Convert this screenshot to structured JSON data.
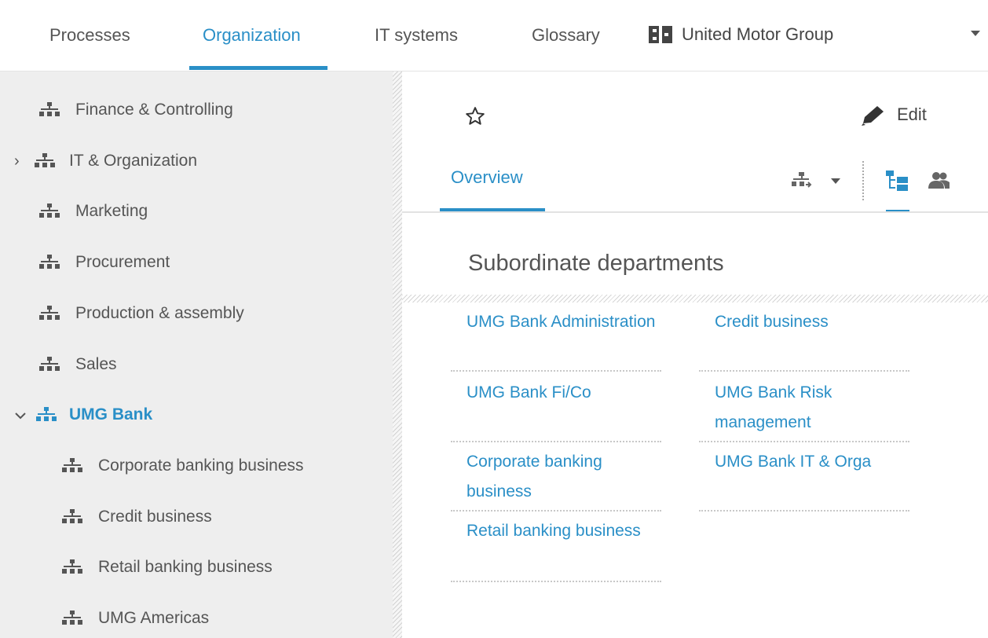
{
  "topnav": {
    "tabs": [
      {
        "label": "Processes"
      },
      {
        "label": "Organization"
      },
      {
        "label": "IT systems"
      },
      {
        "label": "Glossary"
      }
    ],
    "active_tab": "Organization",
    "group_selector": {
      "label": "United Motor Group",
      "icon": "building-icon"
    }
  },
  "sidebar": {
    "items": [
      {
        "label": "Finance & Controlling",
        "icon": "org-chart-icon"
      },
      {
        "label": "IT & Organization",
        "icon": "org-chart-icon",
        "expander": "›"
      },
      {
        "label": "Marketing",
        "icon": "org-chart-icon"
      },
      {
        "label": "Procurement",
        "icon": "org-chart-icon"
      },
      {
        "label": "Production & assembly",
        "icon": "org-chart-icon"
      },
      {
        "label": "Sales",
        "icon": "org-chart-icon"
      },
      {
        "label": "UMG Bank",
        "icon": "org-chart-icon",
        "selected": true
      },
      {
        "label": "Corporate banking business",
        "icon": "org-chart-icon"
      },
      {
        "label": "Credit business",
        "icon": "org-chart-icon"
      },
      {
        "label": "Retail banking business",
        "icon": "org-chart-icon"
      },
      {
        "label": "UMG Americas",
        "icon": "org-chart-icon"
      }
    ]
  },
  "main": {
    "edit_label": "Edit",
    "tabs": [
      {
        "label": "Overview"
      }
    ],
    "section_title": "Subordinate departments",
    "departments": [
      {
        "label": "UMG Bank Administration"
      },
      {
        "label": "Credit business"
      },
      {
        "label": "UMG Bank Fi/Co"
      },
      {
        "label": "UMG Bank Risk management"
      },
      {
        "label": "Corporate banking business"
      },
      {
        "label": "UMG Bank IT & Orga"
      },
      {
        "label": "Retail banking business"
      }
    ]
  },
  "colors": {
    "accent": "#2a8fc7",
    "sidebar_bg": "#eeeeee",
    "text": "#555555"
  }
}
